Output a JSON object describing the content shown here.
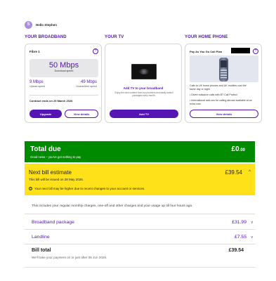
{
  "user": {
    "initial": "S",
    "name": "Hello Stephen"
  },
  "sections": {
    "broadband_title": "YOUR BROADBAND",
    "tv_title": "YOUR TV",
    "phone_title": "YOUR HOME PHONE"
  },
  "broadband": {
    "name": "Fibre 1",
    "download_speed": "50 Mbps",
    "download_label": "Download speed",
    "upload_speed": "9 Mbps",
    "upload_label": "Upload speed",
    "guaranteed_speed": "49 Mbps",
    "guaranteed_label": "Guaranteed speed",
    "contract": "Contract ends on 29 March 2026",
    "upgrade_label": "Upgrade",
    "view_details_label": "View details"
  },
  "tv": {
    "title": "Add TV to your broadband",
    "description": "Enjoy the best content from top providers and easily switch packages every month.",
    "add_tv_label": "Add TV"
  },
  "phone": {
    "name": "Pay As You Go Call Plan",
    "line1": "Calls to UK home phones and UK mobiles cost the",
    "line2": "same day or night.",
    "line3": "• Divert nuisance calls with BT Call Protect",
    "line4": "• International add-ons for calling abroad available at an",
    "line5": "extra cost.",
    "view_details_label": "View details"
  },
  "total_due": {
    "title": "Total due",
    "subtitle": "Good news – you've got nothing to pay",
    "amount_main": "£0",
    "amount_pence": ".00"
  },
  "next_bill": {
    "title": "Next bill estimate",
    "subtitle": "This bill will be issued on 28 May 2026.",
    "warning": "Your next bill may be higher due to recent changes to your account or services.",
    "amount": "£39.54"
  },
  "info_text": "This includes your regular monthly charges, one-off and other charges and your usage up till four hours ago.",
  "rows": [
    {
      "label": "Broadband package",
      "amount": "£31.99"
    },
    {
      "label": "Landline",
      "amount": "£7.55"
    }
  ],
  "bill_total": {
    "label": "Bill total",
    "note": "We'll take your payment on or just after 05 Jun 2026.",
    "amount": "£39.54"
  },
  "colors": {
    "brand": "#5514b4",
    "total_due_bg": "#008a00",
    "next_bill_bg": "#ffe11a"
  }
}
